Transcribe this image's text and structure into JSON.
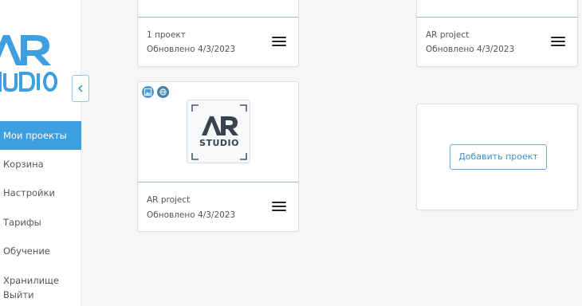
{
  "sidebar": {
    "logo_text": "AR STUDIO",
    "items": [
      {
        "label": "Мои проекты",
        "active": true
      },
      {
        "label": "Корзина"
      },
      {
        "label": "Настройки"
      },
      {
        "label": "Тарифы"
      },
      {
        "label": "Обучение"
      },
      {
        "label": "Хранилище"
      },
      {
        "label": "Выйти"
      }
    ]
  },
  "cards": [
    {
      "title": "1 проект",
      "updated": "Обновлено 4/3/2023"
    },
    {
      "title": "AR project",
      "updated": "Обновлено 4/3/2023"
    },
    {
      "title": "AR project",
      "updated": "Обновлено 4/3/2023",
      "badges": [
        "image-icon",
        "globe-icon"
      ],
      "thumbnail_logo": "AR STUDIO"
    }
  ],
  "add_project_label": "Добавить проект",
  "colors": {
    "accent": "#3d9ee0",
    "background": "#f5f7f6",
    "logo_dark": "#3a4350"
  }
}
